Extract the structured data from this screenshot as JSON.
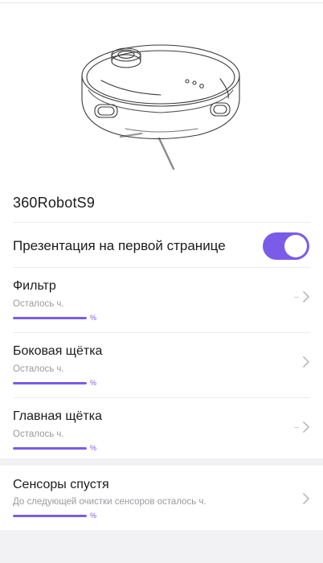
{
  "device": {
    "name": "360RobotS9",
    "illustration_icon": "robot-vacuum-icon"
  },
  "featured": {
    "label": "Презентация на первой странице",
    "enabled": true
  },
  "consumables": [
    {
      "title": "Фильтр",
      "subtitle": "Осталось ч.",
      "percent_label": "%",
      "progress": 1.0
    },
    {
      "title": "Боковая щётка",
      "subtitle": "Осталось ч.",
      "percent_label": "%",
      "progress": 1.0
    },
    {
      "title": "Главная щётка",
      "subtitle": "Осталось ч.",
      "percent_label": "%",
      "progress": 1.0
    }
  ],
  "sensors": {
    "title": "Сенсоры спустя",
    "subtitle": "До следующей очистки сенсоров осталось ч.",
    "percent_label": "%",
    "progress": 1.0
  },
  "colors": {
    "accent": "#7a5ce8",
    "background": "#f2f2f4",
    "card": "#ffffff",
    "secondary_text": "#9a9a9f"
  }
}
